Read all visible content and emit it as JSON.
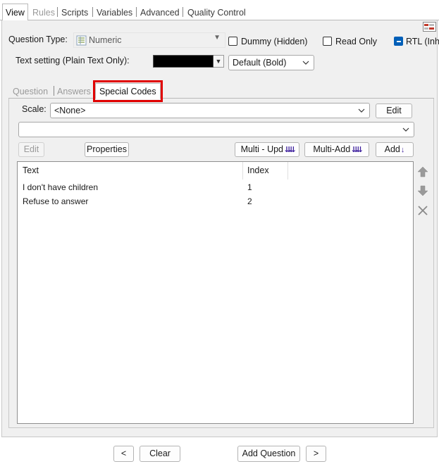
{
  "top_tabs": [
    {
      "label": "View",
      "active": true
    },
    {
      "label": "Rules",
      "disabled": true
    },
    {
      "label": "Scripts"
    },
    {
      "label": "Variables"
    },
    {
      "label": "Advanced"
    },
    {
      "label": "Quality Control"
    }
  ],
  "question_type": {
    "label": "Question Type:",
    "value": "Numeric",
    "icon": "numeric-list-icon"
  },
  "checkboxes": {
    "dummy": {
      "label": "Dummy (Hidden)",
      "checked": false
    },
    "read_only": {
      "label": "Read Only",
      "checked": false
    },
    "rtl": {
      "label": "RTL (Inh",
      "checked": true
    }
  },
  "text_setting": {
    "label": "Text setting (Plain Text Only):",
    "color": "#000000",
    "style_value": "Default (Bold)"
  },
  "inner_tabs": [
    {
      "label": "Question",
      "disabled": true
    },
    {
      "label": "Answers",
      "disabled": true
    },
    {
      "label": "Special Codes",
      "active": true
    }
  ],
  "highlight_color": "#e00000",
  "scale": {
    "label": "Scale:",
    "value": "<None>",
    "edit_label": "Edit"
  },
  "second_dropdown_value": "",
  "toolbar": {
    "edit_label": "Edit",
    "properties_label": "Properties",
    "multi_update_label": "Multi - Upd",
    "multi_add_label": "Multi-Add",
    "add_label": "Add"
  },
  "grid": {
    "columns": [
      "Text",
      "Index"
    ],
    "rows": [
      {
        "text": "I don't have children",
        "index": "1"
      },
      {
        "text": "Refuse to answer",
        "index": "2"
      }
    ]
  },
  "side_icons": [
    "move-up-icon",
    "move-down-icon",
    "delete-x-icon"
  ],
  "bottom": {
    "prev_label": "<",
    "clear_label": "Clear",
    "add_question_label": "Add Question",
    "next_label": ">"
  }
}
